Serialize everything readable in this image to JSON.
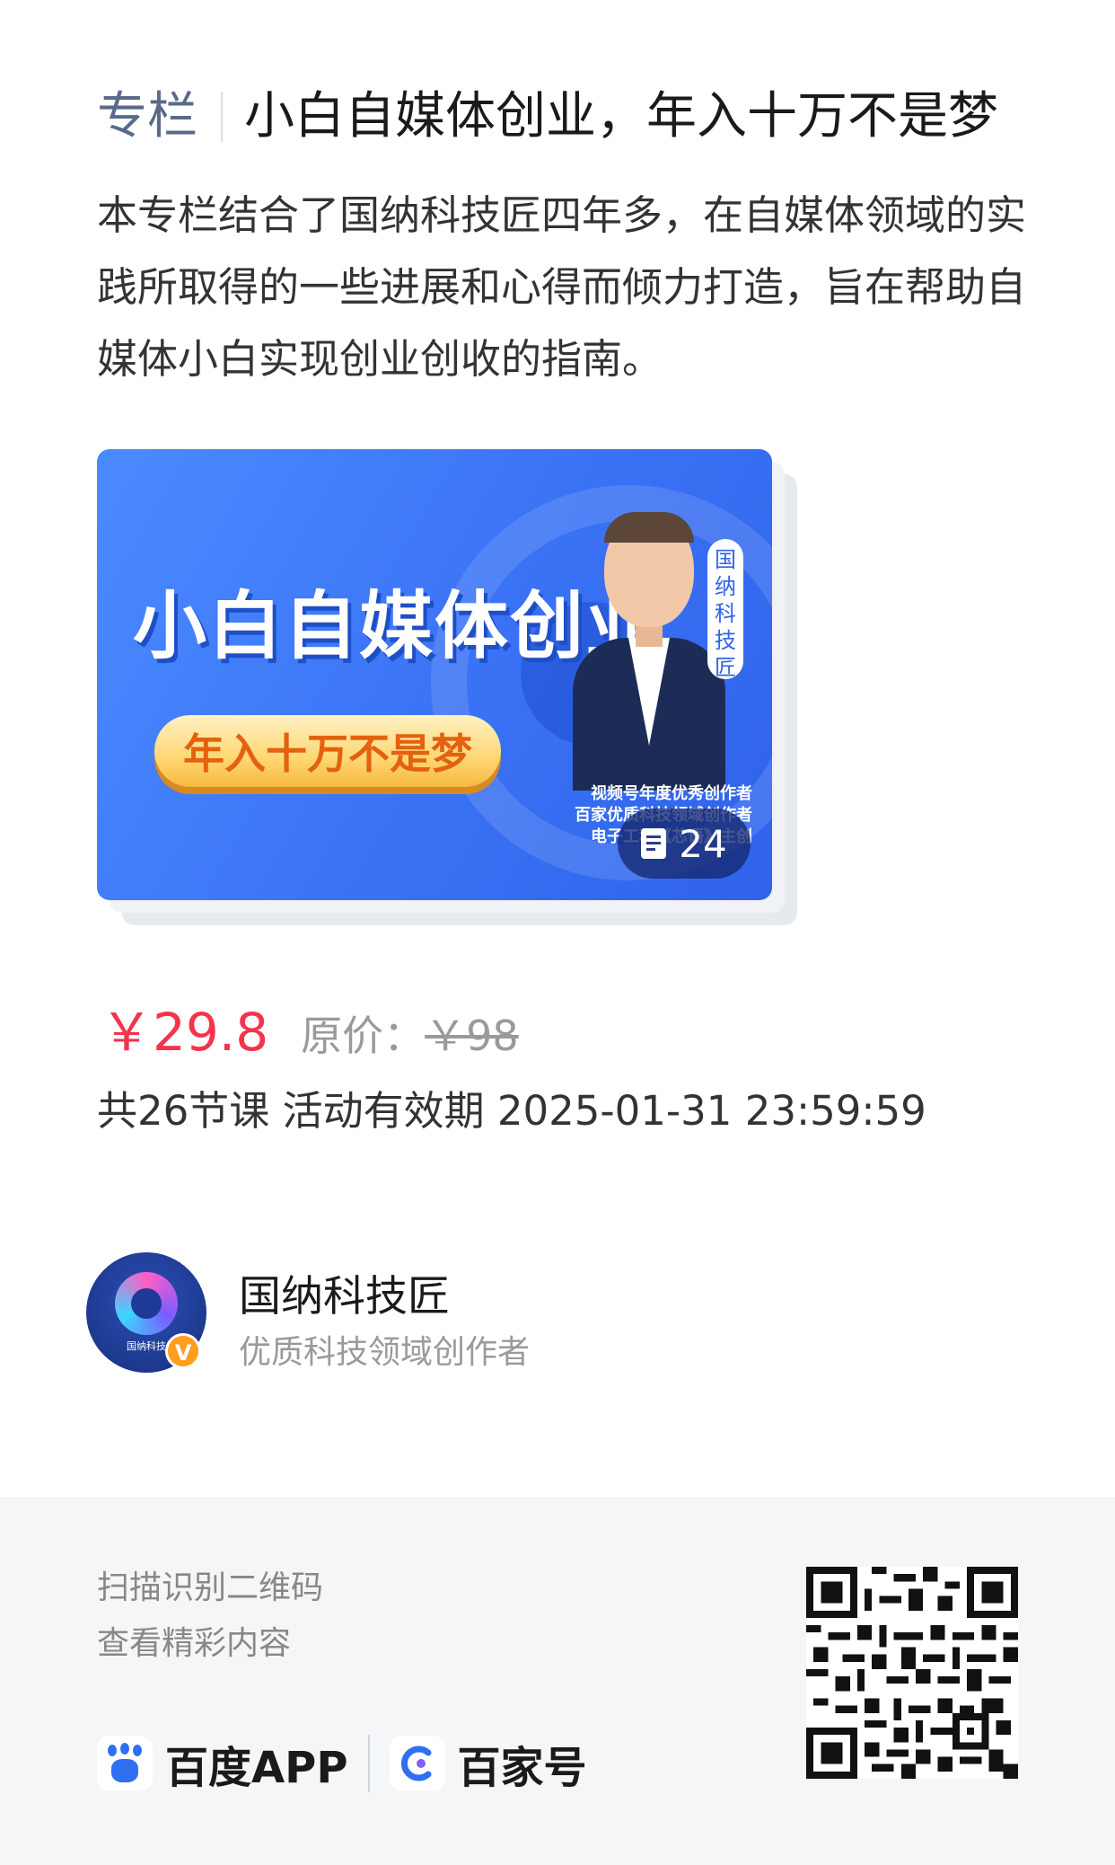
{
  "header": {
    "tag": "专栏",
    "title": "小白自媒体创业，年入十万不是梦"
  },
  "description": "本专栏结合了国纳科技匠四年多，在自媒体领域的实践所取得的一些进展和心得而倾力打造，旨在帮助自媒体小白实现创业创收的指南。",
  "cover": {
    "title": "小白自媒体创业",
    "subtitle": "年入十万不是梦",
    "vertical_label": "国纳科技匠",
    "credit_1": "视频号年度优秀创作者",
    "credit_2": "百家优质科技领域创作者",
    "credit_3": "电子工程《芯语》主创",
    "article_count": "24",
    "count_icon": "document-icon"
  },
  "pricing": {
    "price": "￥29.8",
    "original_label": "原价：",
    "original_price": "￥98"
  },
  "course_info": "共26节课 活动有效期 2025-01-31 23:59:59",
  "author": {
    "name": "国纳科技匠",
    "description": "优质科技领域创作者",
    "avatar_caption": "国纳科技",
    "verified_badge": "V"
  },
  "footer": {
    "scan_line1": "扫描识别二维码",
    "scan_line2": "查看精彩内容",
    "brand1": "百度APP",
    "brand2": "百家号"
  },
  "colors": {
    "price": "#f4344c",
    "accent_blue": "#2f63ea",
    "footer_bg": "#f5f6f8"
  }
}
